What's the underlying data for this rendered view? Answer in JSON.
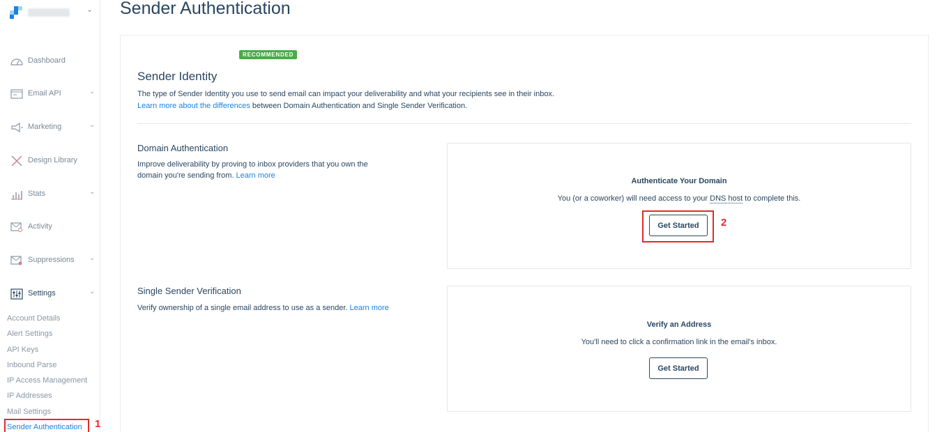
{
  "sidebar": {
    "nav": [
      {
        "label": "Dashboard",
        "icon": "gauge-icon",
        "has_chevron": false
      },
      {
        "label": "Email API",
        "icon": "terminal-icon",
        "has_chevron": true
      },
      {
        "label": "Marketing",
        "icon": "megaphone-icon",
        "has_chevron": true
      },
      {
        "label": "Design Library",
        "icon": "tools-icon",
        "has_chevron": false
      },
      {
        "label": "Stats",
        "icon": "bar-chart-icon",
        "has_chevron": true
      },
      {
        "label": "Activity",
        "icon": "mail-search-icon",
        "has_chevron": false
      },
      {
        "label": "Suppressions",
        "icon": "mail-block-icon",
        "has_chevron": true
      },
      {
        "label": "Settings",
        "icon": "sliders-icon",
        "has_chevron": true
      }
    ],
    "settings_sub": [
      "Account Details",
      "Alert Settings",
      "API Keys",
      "Inbound Parse",
      "IP Access Management",
      "IP Addresses",
      "Mail Settings",
      "Sender Authentication"
    ],
    "chevron": "⌄"
  },
  "annotations": {
    "step1": "1",
    "step2": "2"
  },
  "page": {
    "title": "Sender Authentication",
    "badge": "RECOMMENDED",
    "identity_title": "Sender Identity",
    "identity_desc": "The type of Sender Identity you use to send email can impact your deliverability and what your recipients see in their inbox.",
    "identity_link": "Learn more about the differences",
    "identity_link_tail": " between Domain Authentication and Single Sender Verification."
  },
  "domain": {
    "title": "Domain Authentication",
    "desc_line1": "Improve deliverability by proving to inbox providers that you own the",
    "desc_line2": "domain you're sending from.",
    "link": "Learn more",
    "panel_title": "Authenticate Your Domain",
    "panel_text_pre": "You (or a coworker) will need access to your ",
    "panel_text_dns": "DNS host",
    "panel_text_post": " to complete this.",
    "button": "Get Started"
  },
  "single": {
    "title": "Single Sender Verification",
    "desc": "Verify ownership of a single email address to use as a sender.",
    "link": "Learn more",
    "panel_title": "Verify an Address",
    "panel_text": "You'll need to click a confirmation link in the email's inbox.",
    "button": "Get Started"
  },
  "colors": {
    "accent": "#1a82e2",
    "text": "#294661",
    "badge": "#4aab4a",
    "annotation": "#e32a2a"
  }
}
